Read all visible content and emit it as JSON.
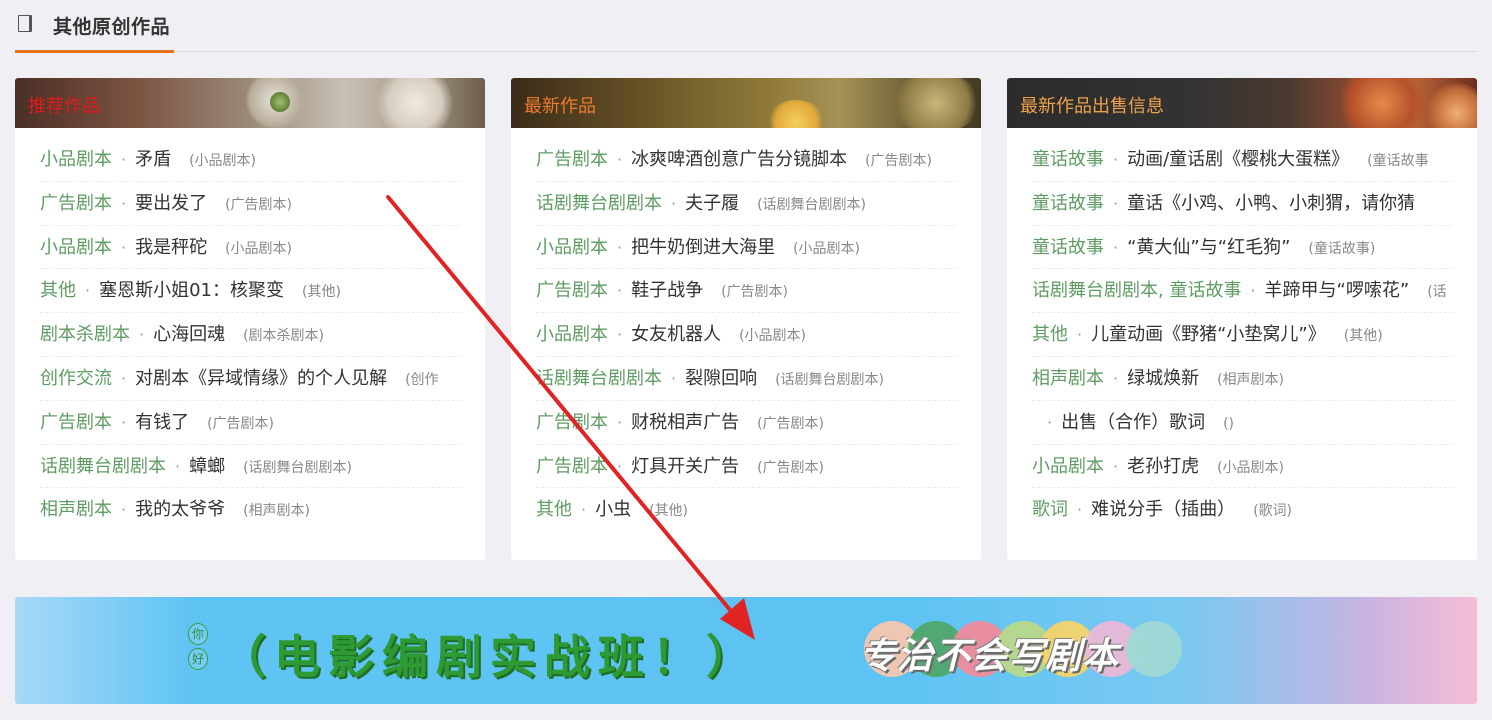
{
  "section": {
    "title": "其他原创作品"
  },
  "columns": [
    {
      "title": "推荐作品",
      "title_color": "#e01b1b",
      "items": [
        {
          "category": "小品剧本",
          "title": "矛盾",
          "tag": "(小品剧本)"
        },
        {
          "category": "广告剧本",
          "title": "要出发了",
          "tag": "(广告剧本)"
        },
        {
          "category": "小品剧本",
          "title": "我是秤砣",
          "tag": "(小品剧本)"
        },
        {
          "category": "其他",
          "title": "塞恩斯小姐01：核聚变",
          "tag": "(其他)"
        },
        {
          "category": "剧本杀剧本",
          "title": "心海回魂",
          "tag": "(剧本杀剧本)"
        },
        {
          "category": "创作交流",
          "title": "对剧本《异域情缘》的个人见解",
          "tag": "(创作"
        },
        {
          "category": "广告剧本",
          "title": "有钱了",
          "tag": "(广告剧本)"
        },
        {
          "category": "话剧舞台剧剧本",
          "title": "蟑螂",
          "tag": "(话剧舞台剧剧本)"
        },
        {
          "category": "相声剧本",
          "title": "我的太爷爷",
          "tag": "(相声剧本)"
        }
      ]
    },
    {
      "title": "最新作品",
      "title_color": "#f07a2a",
      "items": [
        {
          "category": "广告剧本",
          "title": "冰爽啤酒创意广告分镜脚本",
          "tag": "(广告剧本)"
        },
        {
          "category": "话剧舞台剧剧本",
          "title": "夫子履",
          "tag": "(话剧舞台剧剧本)"
        },
        {
          "category": "小品剧本",
          "title": "把牛奶倒进大海里",
          "tag": "(小品剧本)"
        },
        {
          "category": "广告剧本",
          "title": "鞋子战争",
          "tag": "(广告剧本)"
        },
        {
          "category": "小品剧本",
          "title": "女友机器人",
          "tag": "(小品剧本)"
        },
        {
          "category": "话剧舞台剧剧本",
          "title": "裂隙回响",
          "tag": "(话剧舞台剧剧本)"
        },
        {
          "category": "广告剧本",
          "title": "财税相声广告",
          "tag": "(广告剧本)"
        },
        {
          "category": "广告剧本",
          "title": "灯具开关广告",
          "tag": "(广告剧本)"
        },
        {
          "category": "其他",
          "title": "小虫",
          "tag": "(其他)"
        }
      ]
    },
    {
      "title": "最新作品出售信息",
      "title_color": "#f0a24a",
      "items": [
        {
          "category": "童话故事",
          "title": "动画/童话剧《樱桃大蛋糕》",
          "tag": "(童话故事"
        },
        {
          "category": "童话故事",
          "title": "童话《小鸡、小鸭、小刺猬，请你猜",
          "tag": ""
        },
        {
          "category": "童话故事",
          "title": "“黄大仙”与“红毛狗”",
          "tag": "(童话故事)"
        },
        {
          "category": "话剧舞台剧剧本, 童话故事",
          "title": "羊蹄甲与“啰嗦花”",
          "tag": "(话"
        },
        {
          "category": "其他",
          "title": "儿童动画《野猪“小垫窝儿”》",
          "tag": "(其他)"
        },
        {
          "category": "相声剧本",
          "title": "绿城焕新",
          "tag": "(相声剧本)"
        },
        {
          "category": "",
          "title": "出售（合作）歌词",
          "tag": "()"
        },
        {
          "category": "小品剧本",
          "title": "老孙打虎",
          "tag": "(小品剧本)"
        },
        {
          "category": "歌词",
          "title": "难说分手（插曲）",
          "tag": "(歌词)"
        }
      ]
    }
  ],
  "ad": {
    "hello_1": "你",
    "hello_2": "好",
    "main_text": "（电影编剧实战班！）",
    "slogan": "专治不会写剧本"
  },
  "colors": {
    "accent": "#e8721c",
    "category": "#5f9c63",
    "arrow": "#e02424"
  }
}
